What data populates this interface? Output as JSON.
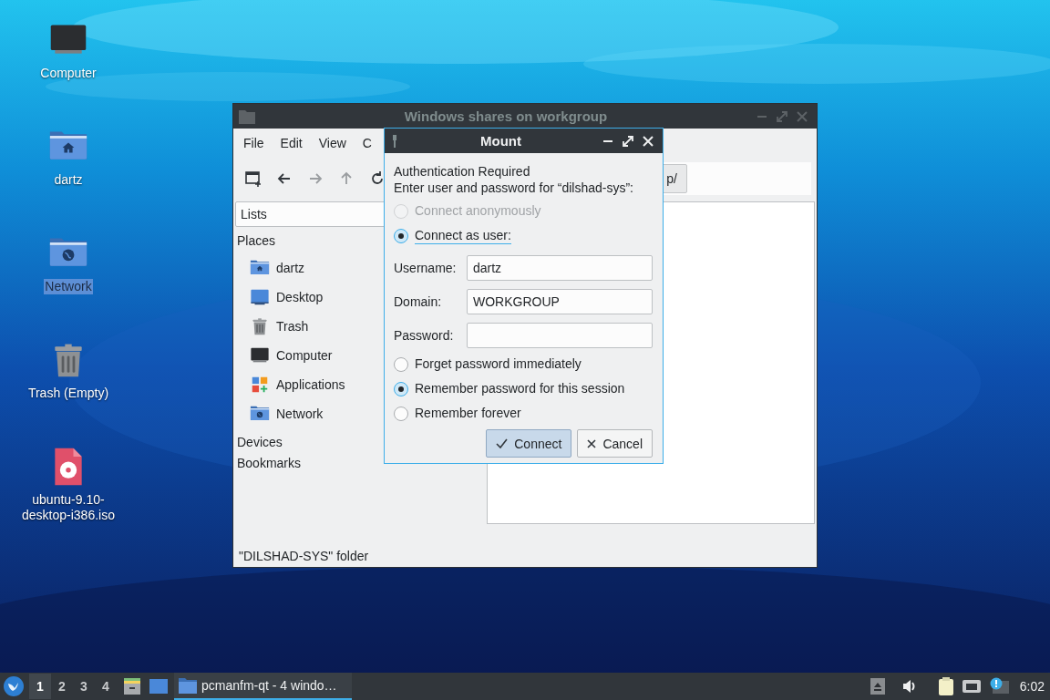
{
  "desktop_icons": [
    {
      "label": "Computer",
      "kind": "computer",
      "selected": false
    },
    {
      "label": "dartz",
      "kind": "home",
      "selected": false
    },
    {
      "label": "Network",
      "kind": "network",
      "selected": true
    },
    {
      "label": "Trash (Empty)",
      "kind": "trash",
      "selected": false
    },
    {
      "label": "ubuntu-9.10-desktop-i386.iso",
      "kind": "disc",
      "selected": false
    }
  ],
  "file_manager": {
    "title": "Windows shares on workgroup",
    "menu": [
      "File",
      "Edit",
      "View",
      "C"
    ],
    "path_segment": "p/",
    "side_pane": {
      "mode": "Lists",
      "sections": [
        {
          "title": "Places",
          "items": [
            {
              "label": "dartz",
              "kind": "home"
            },
            {
              "label": "Desktop",
              "kind": "desktop"
            },
            {
              "label": "Trash",
              "kind": "trash"
            },
            {
              "label": "Computer",
              "kind": "computer"
            },
            {
              "label": "Applications",
              "kind": "applications"
            },
            {
              "label": "Network",
              "kind": "network"
            }
          ]
        },
        {
          "title": "Devices"
        },
        {
          "title": "Bookmarks"
        }
      ]
    },
    "status_bar": "\"DILSHAD-SYS\" folder"
  },
  "dialog": {
    "title": "Mount",
    "heading": "Authentication Required",
    "prompt": "Enter user and password for “dilshad-sys”:",
    "auth_options": [
      {
        "label": "Connect anonymously",
        "selected": false,
        "disabled": true,
        "focused": false
      },
      {
        "label": "Connect as user:",
        "selected": true,
        "disabled": false,
        "focused": true
      }
    ],
    "fields": [
      {
        "label": "Username:",
        "value": "dartz"
      },
      {
        "label": "Domain:",
        "value": "WORKGROUP"
      },
      {
        "label": "Password:"
      }
    ],
    "remember_options": [
      {
        "label": "Forget password immediately",
        "selected": false
      },
      {
        "label": "Remember password for this session",
        "selected": true
      },
      {
        "label": "Remember forever",
        "selected": false
      }
    ],
    "buttons": [
      {
        "label": "Connect",
        "kind": "confirm",
        "default": true
      },
      {
        "label": "Cancel",
        "kind": "cancel",
        "default": false
      }
    ]
  },
  "taskbar": {
    "workspaces": [
      {
        "label": "1",
        "selected": true
      },
      {
        "label": "2",
        "selected": false
      },
      {
        "label": "3",
        "selected": false
      },
      {
        "label": "4",
        "selected": false
      }
    ],
    "task": "pcmanfm-qt - 4 windo…",
    "clock": "6:02"
  }
}
